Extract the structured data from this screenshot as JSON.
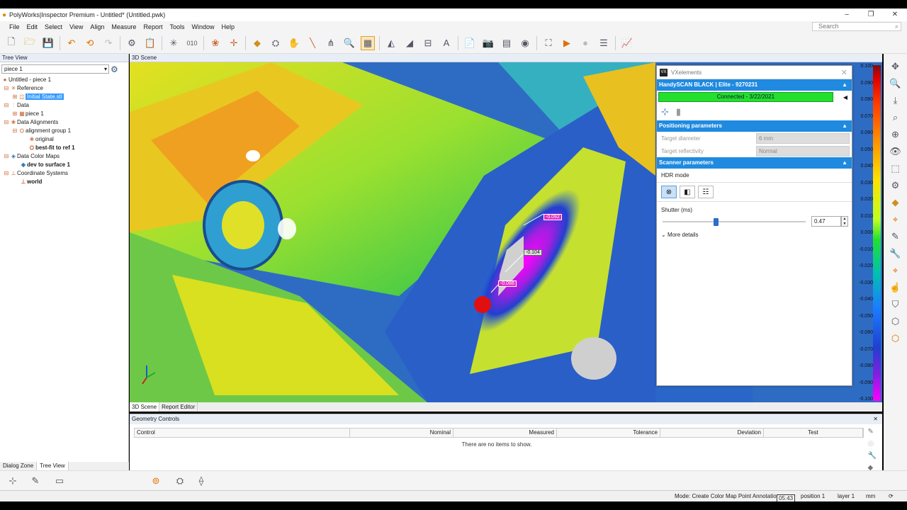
{
  "window": {
    "title": "PolyWorks|Inspector Premium - Untitled* (Untitled.pwk)",
    "controls": [
      "–",
      "❐",
      "✕"
    ]
  },
  "menu": {
    "items": [
      "File",
      "Edit",
      "Select",
      "View",
      "Align",
      "Measure",
      "Report",
      "Tools",
      "Window",
      "Help"
    ],
    "search_placeholder": "Search"
  },
  "tree": {
    "header": "Tree View",
    "piece_select": "piece 1",
    "nodes": [
      {
        "label": "Untitled - piece 1"
      },
      {
        "label": "Reference"
      },
      {
        "label": "Initial State.stl"
      },
      {
        "label": "Data"
      },
      {
        "label": "piece 1"
      },
      {
        "label": "Data Alignments"
      },
      {
        "label": "alignment group 1"
      },
      {
        "label": "original"
      },
      {
        "label": "best-fit to ref 1"
      },
      {
        "label": "Data Color Maps"
      },
      {
        "label": "dev to surface 1"
      },
      {
        "label": "Coordinate Systems"
      },
      {
        "label": "world"
      }
    ],
    "tabs": [
      "Dialog Zone",
      "Tree View"
    ]
  },
  "scene": {
    "header": "3D Scene",
    "tabs": [
      "3D Scene",
      "Report Editor"
    ],
    "annotations": [
      "-0.092",
      "-0.104",
      "-0.088"
    ]
  },
  "vxelements": {
    "title": "VXelements",
    "device": "HandySCAN BLACK | Elite - 9270231",
    "connection": "Connected - 3/22/2021",
    "positioning_header": "Positioning parameters",
    "target_diameter_label": "Target diameter",
    "target_diameter_value": "6 mm",
    "target_reflectivity_label": "Target reflectivity",
    "target_reflectivity_value": "Normal",
    "scanner_header": "Scanner parameters",
    "hdr_label": "HDR mode",
    "shutter_label": "Shutter (ms)",
    "shutter_value": "0.47",
    "shutter_fraction": 0.36,
    "more_details": "More details"
  },
  "legend": {
    "values": [
      "0.100",
      "0.090",
      "0.080",
      "0.070",
      "0.060",
      "0.050",
      "0.040",
      "0.030",
      "0.020",
      "0.010",
      "0.000",
      "-0.010",
      "-0.020",
      "-0.030",
      "-0.040",
      "-0.050",
      "-0.060",
      "-0.070",
      "-0.080",
      "-0.090",
      "-0.100"
    ]
  },
  "geometry_controls": {
    "title": "Geometry Controls",
    "columns": [
      "Control",
      "Nominal",
      "Measured",
      "Tolerance",
      "Deviation",
      "Test"
    ],
    "empty": "There are no items to show."
  },
  "status": {
    "mode": "Mode: Create Color Map Point Annotatio",
    "time": "05:43",
    "position": "position 1",
    "layer": "layer 1",
    "units": "mm"
  }
}
